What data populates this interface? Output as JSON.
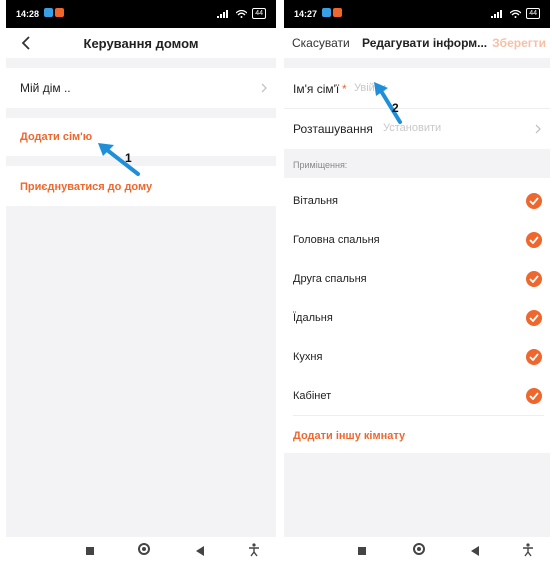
{
  "left": {
    "status": {
      "time": "14:28",
      "battery": "44"
    },
    "header": {
      "title": "Керування домом"
    },
    "home_item": "Мій дім ..",
    "add_family": "Додати сім'ю",
    "join_home": "Приєднуватися до дому",
    "annotation": "1"
  },
  "right": {
    "status": {
      "time": "14:27",
      "battery": "44"
    },
    "header": {
      "cancel": "Скасувати",
      "title": "Редагувати інформ...",
      "save": "Зберегти"
    },
    "family_name_label": "Ім'я сім'ї",
    "required_mark": "*",
    "family_name_placeholder": "Увійти",
    "location_label": "Розташування",
    "location_value": "Установити",
    "rooms_section": "Приміщення:",
    "rooms": [
      "Вітальня",
      "Головна спальня",
      "Друга спальня",
      "Їдальня",
      "Кухня",
      "Кабінет"
    ],
    "add_room": "Додати іншу кімнату",
    "annotation": "2"
  },
  "colors": {
    "accent": "#f0672e",
    "arrow": "#1e8fd8"
  }
}
